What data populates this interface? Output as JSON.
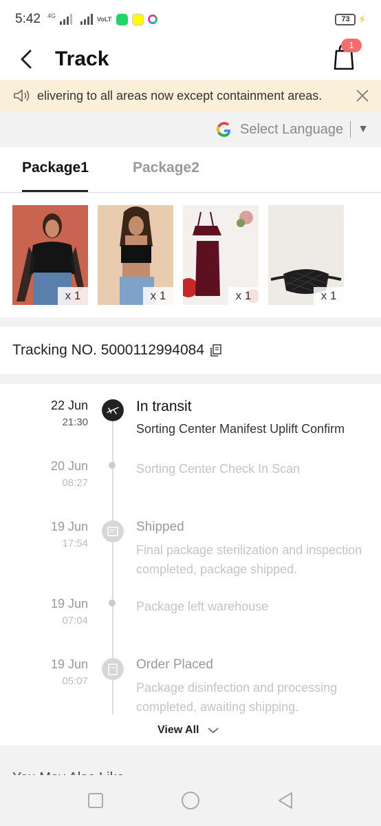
{
  "status_bar": {
    "time": "5:42",
    "network": "4G",
    "volte": "VoLTE",
    "battery": "73"
  },
  "header": {
    "title": "Track",
    "cart_count": "1"
  },
  "notice": {
    "text": "elivering to all areas now except containment areas."
  },
  "language": {
    "label": "Select Language"
  },
  "tabs": [
    {
      "label": "Package1",
      "active": true
    },
    {
      "label": "Package2",
      "active": false
    }
  ],
  "products": [
    {
      "name": "black-top-mesh-sleeves",
      "qty": "x 1"
    },
    {
      "name": "black-crop-cami",
      "qty": "x 1"
    },
    {
      "name": "burgundy-two-piece-set",
      "qty": "x 1"
    },
    {
      "name": "black-quilted-belt-bag",
      "qty": "x 1"
    }
  ],
  "tracking": {
    "label": "Tracking NO. 5000112994084"
  },
  "timeline": [
    {
      "date": "22 Jun",
      "time": "21:30",
      "title": "In transit",
      "desc": "Sorting Center Manifest Uplift Confirm",
      "icon": "airplane-icon",
      "active": true
    },
    {
      "date": "20 Jun",
      "time": "08:27",
      "title": "",
      "desc": "Sorting Center Check In Scan",
      "icon": "dot",
      "active": false
    },
    {
      "date": "19 Jun",
      "time": "17:54",
      "title": "Shipped",
      "desc": "Final package sterilization and inspection completed, package shipped.",
      "icon": "package-icon",
      "active": false
    },
    {
      "date": "19 Jun",
      "time": "07:04",
      "title": "",
      "desc": "Package left warehouse",
      "icon": "dot",
      "active": false
    },
    {
      "date": "19 Jun",
      "time": "05:07",
      "title": "Order Placed",
      "desc": "Package disinfection and processing completed, awaiting shipping.",
      "icon": "order-icon",
      "active": false
    }
  ],
  "view_all": "View All",
  "bottom_heading": "You May Also Like",
  "colors": {
    "accent_badge": "#f26d6d",
    "notice_bg": "#faefd9",
    "active_node": "#222222",
    "inactive_text": "#c4c4c4"
  }
}
